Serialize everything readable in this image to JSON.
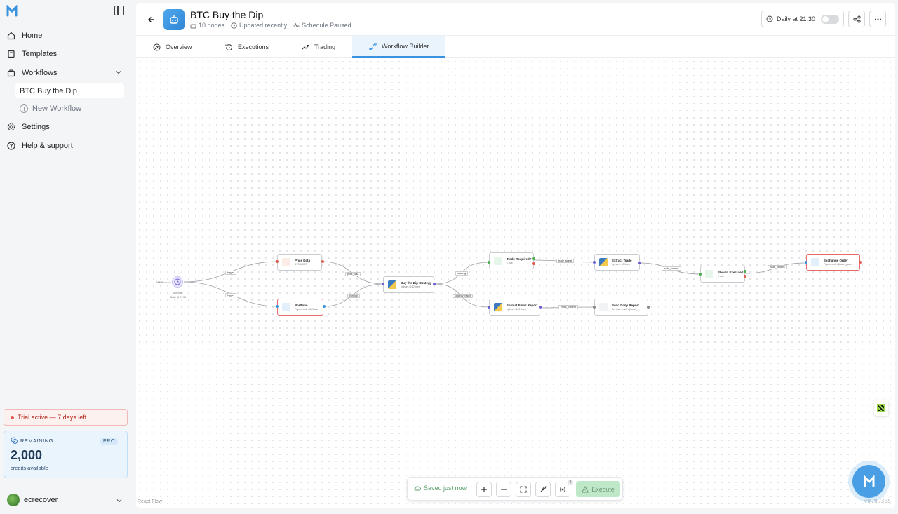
{
  "sidebar": {
    "nav": {
      "home": "Home",
      "templates": "Templates",
      "workflows": "Workflows",
      "settings": "Settings",
      "help": "Help & support"
    },
    "workflow_items": [
      "BTC Buy the Dip"
    ],
    "new_workflow": "New Workflow",
    "trial": "Trial active — 7 days left",
    "credits": {
      "label": "REMAINING",
      "plan": "PRO",
      "amount": "2,000",
      "sub": "credits available"
    },
    "user": "ecrecover"
  },
  "header": {
    "title": "BTC Buy the Dip",
    "nodes": "10 nodes",
    "updated": "Updated recently",
    "schedule_status": "Schedule Paused",
    "schedule_label": "Daily at 21:30",
    "schedule_enabled": false
  },
  "tabs": [
    "Overview",
    "Executions",
    "Trading",
    "Workflow Builder"
  ],
  "active_tab": "Workflow Builder",
  "canvas": {
    "start_label": "START",
    "schedule_title": "Schedule",
    "schedule_sub": "Daily @ 21:30",
    "nodes": {
      "price": {
        "title": "Price Data",
        "sub": "BTC/USDT"
      },
      "portfolio": {
        "title": "Portfolio",
        "sub": "Papermock • All Data"
      },
      "strategy": {
        "title": "Buy the Dip Strategy",
        "sub": "python • 212 lines"
      },
      "trade_req": {
        "title": "Trade Required?",
        "sub": "1 rule"
      },
      "extract": {
        "title": "Extract Trade",
        "sub": "python • 43 lines"
      },
      "should": {
        "title": "Should Execute?",
        "sub": "1 rule"
      },
      "exchange": {
        "title": "Exchange Order",
        "sub": "Papermock • {trade_para..."
      },
      "email": {
        "title": "Format Email Report",
        "sub": "python • 101 lines"
      },
      "send": {
        "title": "Send Daily Report",
        "sub": "To: Your email • {email_..."
      }
    },
    "edges": {
      "trigger1": "trigger",
      "trigger2": "trigger",
      "price_data": "price_data",
      "portfolio": "portfolio",
      "strategy": "strategy",
      "strategy_result": "strategy_result",
      "trade_signal": "trade_signal",
      "trade_params1": "trade_params",
      "trade_params2": "trade_params",
      "email_content": "email_content"
    },
    "attribution": "React Flow",
    "version": "v0.0.305"
  },
  "toolbar": {
    "saved": "Saved just now",
    "variables_count": "0",
    "execute": "Execute"
  },
  "colors": {
    "accent": "#3b93e0",
    "execute_bg": "#bfe8c8",
    "trial": "#b42318"
  }
}
